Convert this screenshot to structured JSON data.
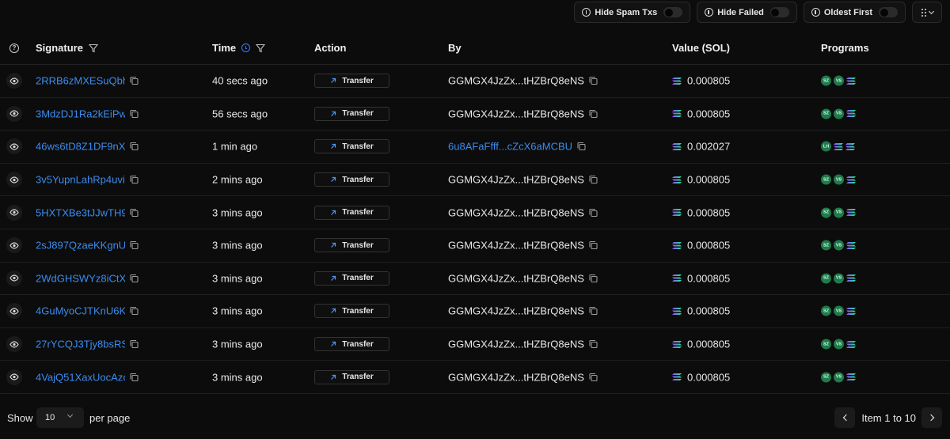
{
  "toolbar": {
    "hide_spam": "Hide Spam Txs",
    "hide_failed": "Hide Failed",
    "oldest_first": "Oldest First"
  },
  "headers": {
    "signature": "Signature",
    "time": "Time",
    "action": "Action",
    "by": "By",
    "value": "Value (SOL)",
    "programs": "Programs"
  },
  "rows": [
    {
      "signature": "2RRB6zMXESuQbh…",
      "time": "40 secs ago",
      "action": "Transfer",
      "by": "GGMGX4JzZx...tHZBrQ8eNS",
      "by_link": false,
      "value": "0.000805",
      "programs": [
        "SZ",
        "VS",
        "SOL"
      ]
    },
    {
      "signature": "3MdzDJ1Ra2kEiPw…",
      "time": "56 secs ago",
      "action": "Transfer",
      "by": "GGMGX4JzZx...tHZBrQ8eNS",
      "by_link": false,
      "value": "0.000805",
      "programs": [
        "SZ",
        "VS",
        "SOL"
      ]
    },
    {
      "signature": "46ws6tD8Z1DF9nX…",
      "time": "1 min ago",
      "action": "Transfer",
      "by": "6u8AFaFfff...cZcX6aMCBU",
      "by_link": true,
      "value": "0.002027",
      "programs": [
        "LH",
        "SOL",
        "SOL"
      ]
    },
    {
      "signature": "3v5YupnLahRp4uvi…",
      "time": "2 mins ago",
      "action": "Transfer",
      "by": "GGMGX4JzZx...tHZBrQ8eNS",
      "by_link": false,
      "value": "0.000805",
      "programs": [
        "SZ",
        "VS",
        "SOL"
      ]
    },
    {
      "signature": "5HXTXBe3tJJwTH9…",
      "time": "3 mins ago",
      "action": "Transfer",
      "by": "GGMGX4JzZx...tHZBrQ8eNS",
      "by_link": false,
      "value": "0.000805",
      "programs": [
        "SZ",
        "VS",
        "SOL"
      ]
    },
    {
      "signature": "2sJ897QzaeKKgnU…",
      "time": "3 mins ago",
      "action": "Transfer",
      "by": "GGMGX4JzZx...tHZBrQ8eNS",
      "by_link": false,
      "value": "0.000805",
      "programs": [
        "SZ",
        "VS",
        "SOL"
      ]
    },
    {
      "signature": "2WdGHSWYz8iCtX…",
      "time": "3 mins ago",
      "action": "Transfer",
      "by": "GGMGX4JzZx...tHZBrQ8eNS",
      "by_link": false,
      "value": "0.000805",
      "programs": [
        "SZ",
        "VS",
        "SOL"
      ]
    },
    {
      "signature": "4GuMyoCJTKnU6K…",
      "time": "3 mins ago",
      "action": "Transfer",
      "by": "GGMGX4JzZx...tHZBrQ8eNS",
      "by_link": false,
      "value": "0.000805",
      "programs": [
        "SZ",
        "VS",
        "SOL"
      ]
    },
    {
      "signature": "27rYCQJ3Tjy8bsRS…",
      "time": "3 mins ago",
      "action": "Transfer",
      "by": "GGMGX4JzZx...tHZBrQ8eNS",
      "by_link": false,
      "value": "0.000805",
      "programs": [
        "SZ",
        "VS",
        "SOL"
      ]
    },
    {
      "signature": "4VajQ51XaxUocAzo…",
      "time": "3 mins ago",
      "action": "Transfer",
      "by": "GGMGX4JzZx...tHZBrQ8eNS",
      "by_link": false,
      "value": "0.000805",
      "programs": [
        "SZ",
        "VS",
        "SOL"
      ]
    }
  ],
  "footer": {
    "show": "Show",
    "per_page_value": "10",
    "per_page": "per page",
    "page_info": "Item 1 to 10"
  },
  "colors": {
    "link": "#3b8cf0",
    "background": "#0c0c0c",
    "badge": "#1f7a4c",
    "sol_gradient": [
      "#9945ff",
      "#14f195"
    ]
  }
}
